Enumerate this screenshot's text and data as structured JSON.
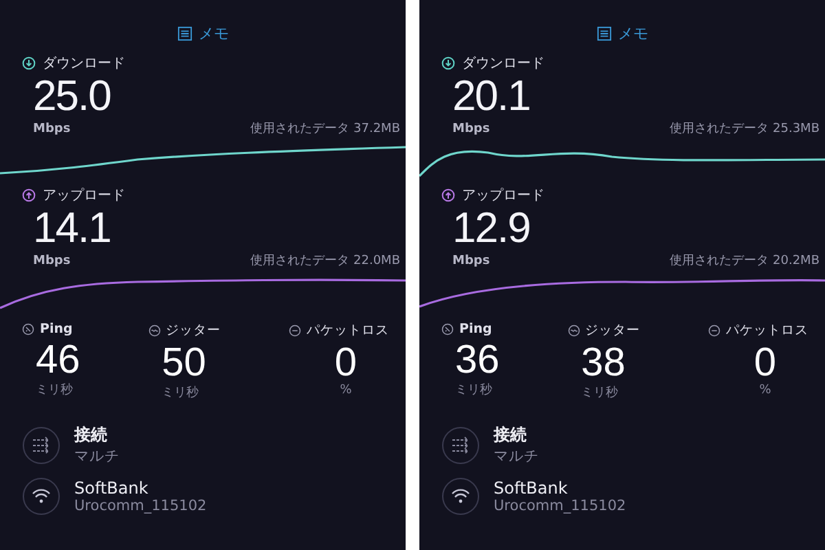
{
  "panels": [
    {
      "memo": "メモ",
      "download": {
        "label": "ダウンロード",
        "value": "25.0",
        "unit": "Mbps",
        "used": "使用されたデータ 37.2MB"
      },
      "upload": {
        "label": "アップロード",
        "value": "14.1",
        "unit": "Mbps",
        "used": "使用されたデータ 22.0MB"
      },
      "metrics": [
        {
          "kind": "ping",
          "label": "Ping",
          "value": "46",
          "unit": "ミリ秒"
        },
        {
          "kind": "jitter",
          "label": "ジッター",
          "value": "50",
          "unit": "ミリ秒"
        },
        {
          "kind": "loss",
          "label": "パケットロス",
          "value": "0",
          "unit": "%"
        }
      ],
      "connection": {
        "title": "接続",
        "value": "マルチ"
      },
      "network": {
        "name": "SoftBank",
        "ssid": "Urocomm_115102"
      }
    },
    {
      "memo": "メモ",
      "download": {
        "label": "ダウンロード",
        "value": "20.1",
        "unit": "Mbps",
        "used": "使用されたデータ 25.3MB"
      },
      "upload": {
        "label": "アップロード",
        "value": "12.9",
        "unit": "Mbps",
        "used": "使用されたデータ 20.2MB"
      },
      "metrics": [
        {
          "kind": "ping",
          "label": "Ping",
          "value": "36",
          "unit": "ミリ秒"
        },
        {
          "kind": "jitter",
          "label": "ジッター",
          "value": "38",
          "unit": "ミリ秒"
        },
        {
          "kind": "loss",
          "label": "パケットロス",
          "value": "0",
          "unit": "%"
        }
      ],
      "connection": {
        "title": "接続",
        "value": "マルチ"
      },
      "network": {
        "name": "SoftBank",
        "ssid": "Urocomm_115102"
      }
    }
  ]
}
